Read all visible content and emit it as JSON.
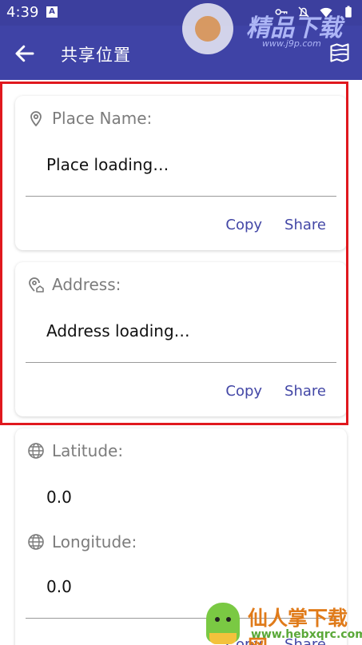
{
  "status_bar": {
    "time": "4:39",
    "notification_glyph": "A",
    "icons": [
      "key-icon",
      "dnd-icon",
      "wifi-icon",
      "battery-icon"
    ]
  },
  "toolbar": {
    "title": "共享位置",
    "back_icon": "arrow-left-icon",
    "map_icon": "map-icon",
    "background": "#3f43a6"
  },
  "cards": {
    "place": {
      "label": "Place Name:",
      "value": "Place loading…",
      "copy": "Copy",
      "share": "Share",
      "icon": "location-pin-icon"
    },
    "address": {
      "label": "Address:",
      "value": "Address loading…",
      "copy": "Copy",
      "share": "Share",
      "icon": "location-home-icon"
    },
    "coords": {
      "latitude_label": "Latitude:",
      "latitude_value": "0.0",
      "longitude_label": "Longitude:",
      "longitude_value": "0.0",
      "copy": "Copy",
      "share": "Share",
      "icon": "globe-icon"
    }
  },
  "watermarks": {
    "top_brand": "精品下载",
    "top_url": "www.j9p.com",
    "bottom_brand": "仙人掌下载网",
    "bottom_url": "www.hebxqrc.com"
  },
  "colors": {
    "accent": "#4347a6",
    "highlight": "#e0181e"
  }
}
